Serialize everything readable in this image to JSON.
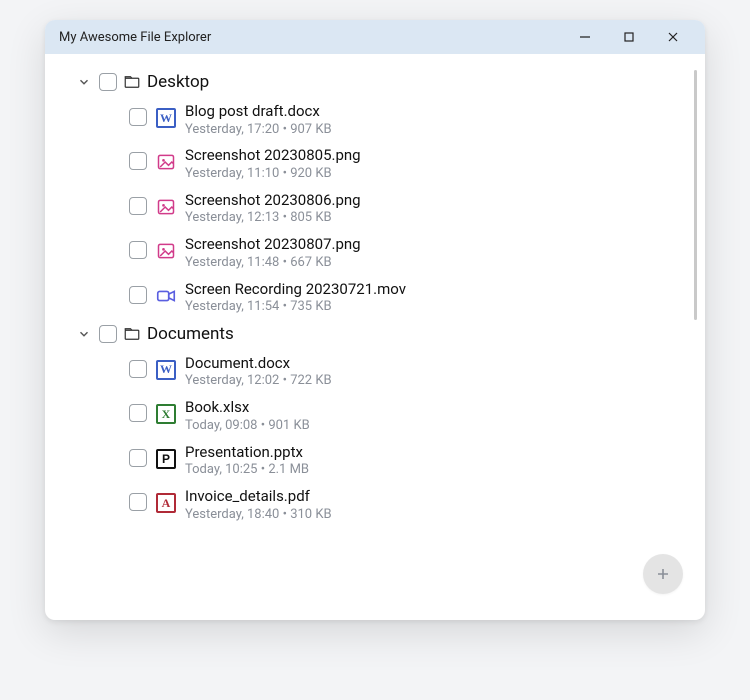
{
  "window": {
    "title": "My Awesome File Explorer"
  },
  "tree": {
    "folders": [
      {
        "name": "Desktop",
        "expanded": true,
        "files": [
          {
            "name": "Blog post draft.docx",
            "meta": "Yesterday, 17:20 • 907 KB",
            "icon": "word"
          },
          {
            "name": "Screenshot 20230805.png",
            "meta": "Yesterday, 11:10 • 920 KB",
            "icon": "image"
          },
          {
            "name": "Screenshot 20230806.png",
            "meta": "Yesterday, 12:13 • 805 KB",
            "icon": "image"
          },
          {
            "name": "Screenshot 20230807.png",
            "meta": "Yesterday, 11:48 • 667 KB",
            "icon": "image"
          },
          {
            "name": "Screen Recording 20230721.mov",
            "meta": "Yesterday, 11:54 • 735 KB",
            "icon": "video"
          }
        ]
      },
      {
        "name": "Documents",
        "expanded": true,
        "files": [
          {
            "name": "Document.docx",
            "meta": "Yesterday, 12:02 • 722 KB",
            "icon": "word"
          },
          {
            "name": "Book.xlsx",
            "meta": "Today, 09:08 • 901 KB",
            "icon": "excel"
          },
          {
            "name": "Presentation.pptx",
            "meta": "Today, 10:25 • 2.1 MB",
            "icon": "ppt"
          },
          {
            "name": "Invoice_details.pdf",
            "meta": "Yesterday, 18:40 • 310 KB",
            "icon": "pdf"
          }
        ]
      }
    ]
  }
}
